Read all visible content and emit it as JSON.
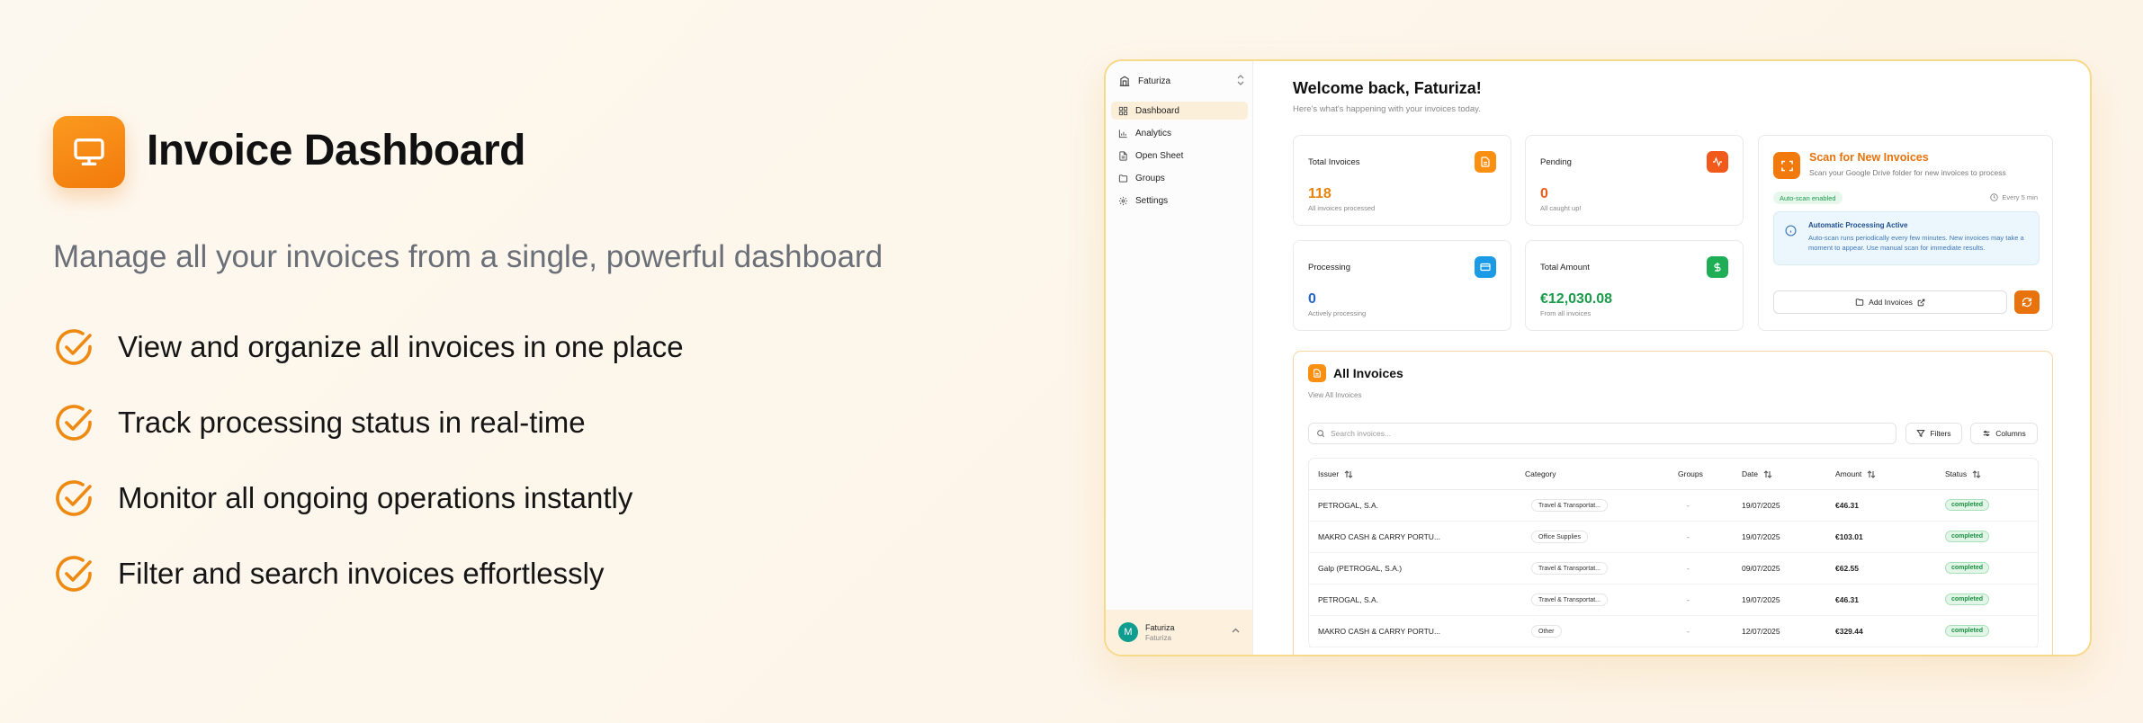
{
  "hero": {
    "title": "Invoice Dashboard",
    "subtitle": "Manage all your invoices from a single, powerful dashboard",
    "features": [
      "View and organize all invoices in one place",
      "Track processing status in real-time",
      "Monitor all ongoing operations instantly",
      "Filter and search invoices effortlessly"
    ],
    "icon": "monitor-icon",
    "accent": "#f27a0c"
  },
  "sidebar": {
    "workspace": "Faturiza",
    "items": [
      {
        "label": "Dashboard",
        "icon": "dashboard-icon",
        "active": true
      },
      {
        "label": "Analytics",
        "icon": "chart-icon"
      },
      {
        "label": "Open Sheet",
        "icon": "sheet-icon"
      },
      {
        "label": "Groups",
        "icon": "folder-icon"
      },
      {
        "label": "Settings",
        "icon": "gear-icon"
      }
    ],
    "user": {
      "initial": "M",
      "name": "Faturiza",
      "email": "Faturiza"
    }
  },
  "main": {
    "welcome": "Welcome back, Faturiza!",
    "welcome_sub": "Here's what's happening with your invoices today.",
    "stats": {
      "total": {
        "title": "Total Invoices",
        "value": "118",
        "sub": "All invoices processed",
        "color": "#e8830c"
      },
      "pending": {
        "title": "Pending",
        "value": "0",
        "sub": "All caught up!",
        "color": "#f25a1c"
      },
      "processing": {
        "title": "Processing",
        "value": "0",
        "sub": "Actively processing",
        "color": "#2764c5"
      },
      "amount": {
        "title": "Total Amount",
        "value": "€12,030.08",
        "sub": "From all invoices",
        "color": "#1a9b4a"
      }
    },
    "scan": {
      "title": "Scan for New Invoices",
      "subtitle": "Scan your Google Drive folder for new invoices to process",
      "badge": "Auto-scan enabled",
      "interval": "Every 5 min",
      "info_title": "Automatic Processing Active",
      "info_text": "Auto-scan runs periodically every few minutes. New invoices may take a moment to appear. Use manual scan for immediate results.",
      "add_label": "Add Invoices"
    },
    "invoices": {
      "title": "All Invoices",
      "link": "View All Invoices",
      "search_placeholder": "Search invoices...",
      "filters_label": "Filters",
      "columns_label": "Columns",
      "headers": {
        "issuer": "Issuer",
        "category": "Category",
        "groups": "Groups",
        "date": "Date",
        "amount": "Amount",
        "status": "Status"
      },
      "rows": [
        {
          "issuer": "PETROGAL, S.A.",
          "category": "Travel & Transportat...",
          "groups": "-",
          "date": "19/07/2025",
          "amount": "€46.31",
          "status": "completed"
        },
        {
          "issuer": "MAKRO CASH & CARRY PORTU...",
          "category": "Office Supplies",
          "groups": "-",
          "date": "19/07/2025",
          "amount": "€103.01",
          "status": "completed"
        },
        {
          "issuer": "Galp (PETROGAL, S.A.)",
          "category": "Travel & Transportat...",
          "groups": "-",
          "date": "09/07/2025",
          "amount": "€62.55",
          "status": "completed"
        },
        {
          "issuer": "PETROGAL, S.A.",
          "category": "Travel & Transportat...",
          "groups": "-",
          "date": "19/07/2025",
          "amount": "€46.31",
          "status": "completed"
        },
        {
          "issuer": "MAKRO CASH & CARRY PORTU...",
          "category": "Other",
          "groups": "-",
          "date": "12/07/2025",
          "amount": "€329.44",
          "status": "completed"
        }
      ]
    }
  }
}
